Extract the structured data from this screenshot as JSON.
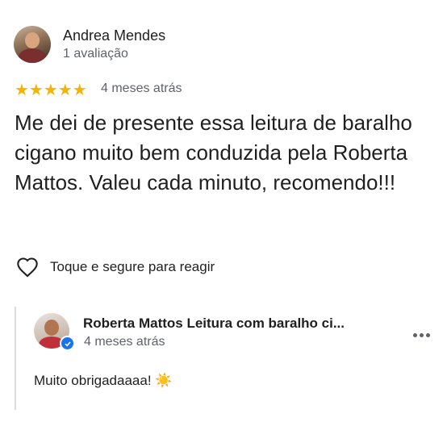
{
  "review": {
    "author_name": "Andrea Mendes",
    "author_meta": "1 avaliação",
    "rating": 5,
    "stars_text": "★★★★★",
    "time": "4 meses atrás",
    "text": "Me dei de presente essa leitura de baralho cigano muito bem conduzida pela Roberta Mattos. Valeu cada minuto, recomendo!!!",
    "react_label": "Toque e segure para reagir"
  },
  "reply": {
    "owner_name": "Roberta Mattos Leitura com baralho ci...",
    "time": "4 meses atrás",
    "text": "Muito obrigadaaaa! ☀️"
  },
  "colors": {
    "star": "#f4b400",
    "verified": "#1a73e8",
    "secondary_text": "#5f6368"
  }
}
